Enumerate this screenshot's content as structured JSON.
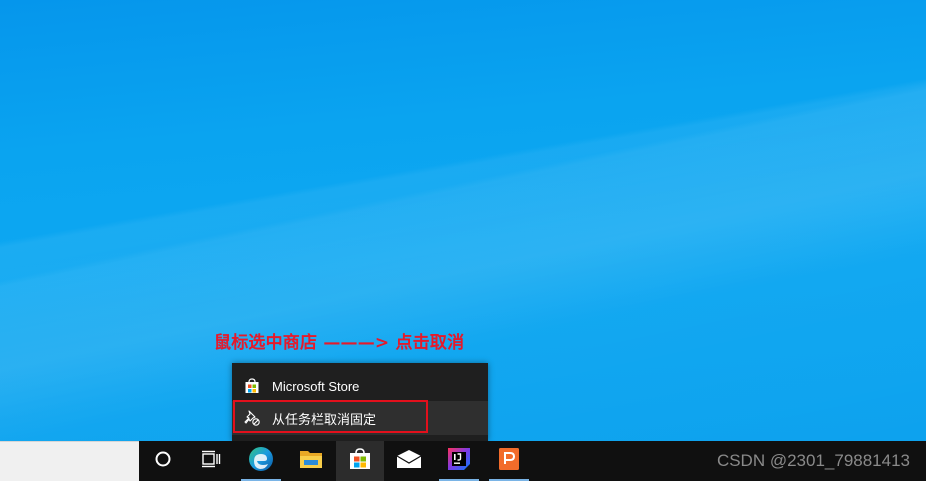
{
  "annotation": {
    "text": "鼠标选中商店 ———> 点击取消",
    "color": "#e51a2b"
  },
  "context_menu": {
    "items": [
      {
        "label": "Microsoft Store",
        "icon": "store-icon"
      },
      {
        "label": "从任务栏取消固定",
        "icon": "unpin-icon"
      }
    ]
  },
  "taskbar": {
    "buttons": [
      {
        "icon": "cortana-icon"
      },
      {
        "icon": "task-view-icon"
      },
      {
        "icon": "edge-icon"
      },
      {
        "icon": "file-explorer-icon"
      },
      {
        "icon": "store-icon",
        "active": true
      },
      {
        "icon": "mail-icon"
      },
      {
        "icon": "intellij-idea-icon"
      },
      {
        "icon": "powerpoint-icon"
      }
    ]
  },
  "watermark": "CSDN @2301_79881413",
  "colors": {
    "desktop": "#0aa4f0",
    "taskbar": "#101010",
    "menu": "#1f1f1f",
    "highlight": "#e3101c"
  }
}
